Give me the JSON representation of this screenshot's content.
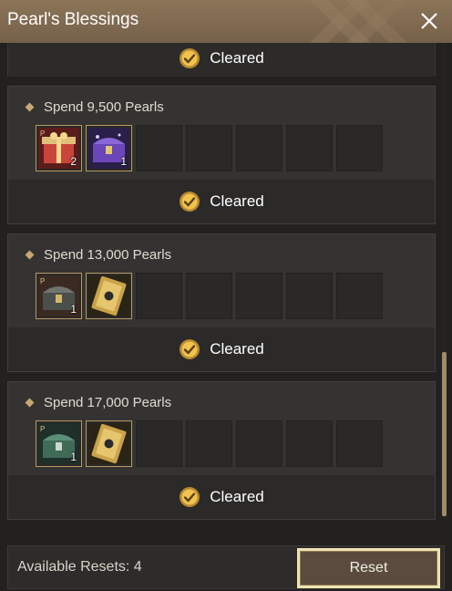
{
  "window": {
    "title": "Pearl's Blessings"
  },
  "partial_card": {
    "status": "Cleared"
  },
  "cards": [
    {
      "title": "Spend 9,500 Pearls",
      "status": "Cleared",
      "items": [
        {
          "icon": "red-gift-box-icon",
          "qty": "2"
        },
        {
          "icon": "purple-treasure-chest-icon",
          "qty": "1"
        }
      ]
    },
    {
      "title": "Spend 13,000 Pearls",
      "status": "Cleared",
      "items": [
        {
          "icon": "dark-treasure-chest-icon",
          "qty": "1"
        },
        {
          "icon": "gold-ticket-icon",
          "qty": ""
        }
      ]
    },
    {
      "title": "Spend 17,000 Pearls",
      "status": "Cleared",
      "items": [
        {
          "icon": "green-treasure-chest-icon",
          "qty": "1"
        },
        {
          "icon": "gold-ticket-icon",
          "qty": ""
        }
      ]
    }
  ],
  "footer": {
    "available_resets": "Available Resets: 4",
    "reset_label": "Reset"
  },
  "colors": {
    "header": "#7d6850",
    "accent_gold": "#c9a772",
    "reset_border": "#efe3b0",
    "panel": "#343332"
  }
}
